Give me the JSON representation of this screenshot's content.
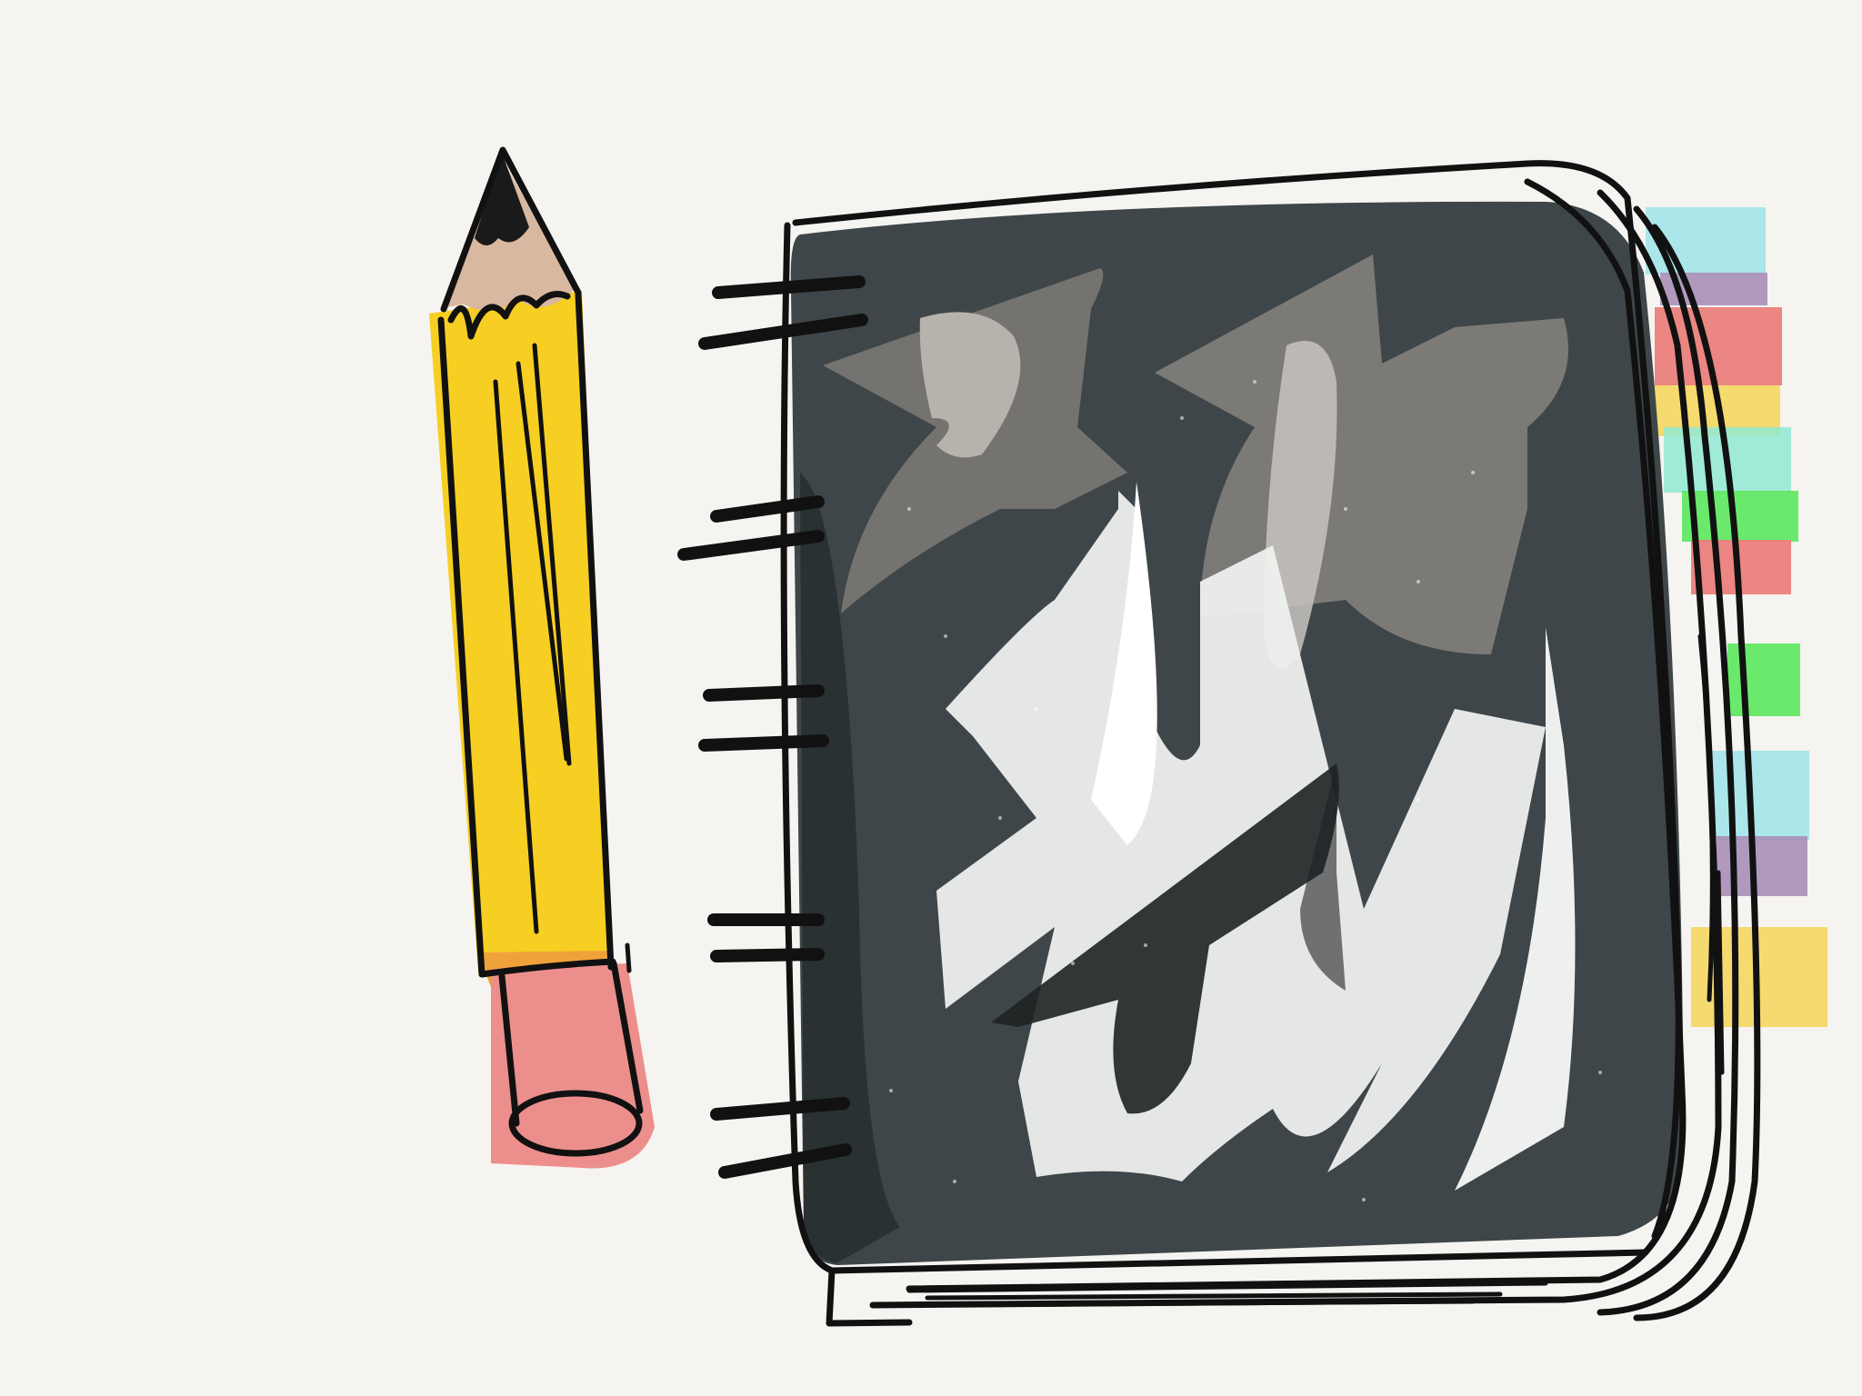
{
  "image": {
    "background": "#f6f4f1",
    "ink": "#111111"
  },
  "pencil": {
    "icon": "pencil-icon",
    "body_color": "#f6cf22",
    "wood_color": "#d8b8a0",
    "lead_color": "#1a1a1a",
    "ferrule_color": "#f0a23a",
    "eraser_color": "#ec8f8c"
  },
  "sketchbook": {
    "icon": "spiral-sketchbook-icon",
    "cover_color": "#3e4649",
    "shape_light": "#eef0ef",
    "shape_mid": "#8c8782",
    "shape_dark": "#1e2223",
    "spiral_rings": 6,
    "tab_colors": [
      "#9ee3ea",
      "#a98fb7",
      "#ea807c",
      "#f4d760",
      "#90e9d2",
      "#62e865",
      "#ea807c",
      "#62e865",
      "#9ee3ea",
      "#a98fb7",
      "#f4d760"
    ]
  }
}
